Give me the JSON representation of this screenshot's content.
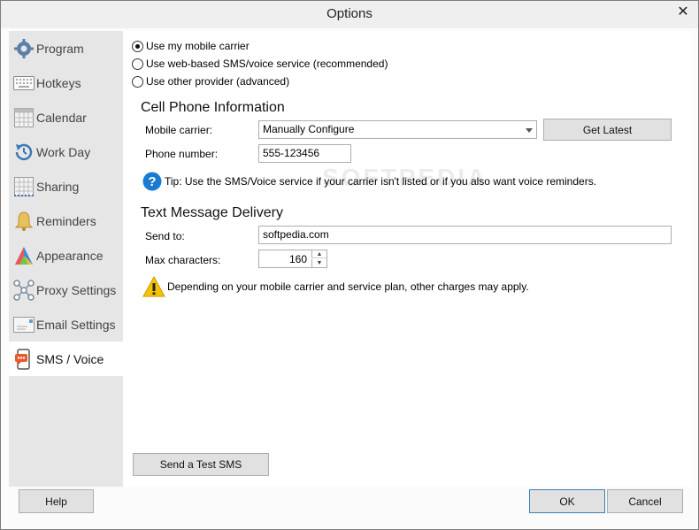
{
  "window": {
    "title": "Options",
    "close_glyph": "✕"
  },
  "sidebar": {
    "items": [
      {
        "label": "Program",
        "icon": "gear-icon"
      },
      {
        "label": "Hotkeys",
        "icon": "keyboard-icon"
      },
      {
        "label": "Calendar",
        "icon": "calendar-icon"
      },
      {
        "label": "Work Day",
        "icon": "clock-icon"
      },
      {
        "label": "Sharing",
        "icon": "sharing-icon"
      },
      {
        "label": "Reminders",
        "icon": "bell-icon"
      },
      {
        "label": "Appearance",
        "icon": "palette-icon"
      },
      {
        "label": "Proxy Settings",
        "icon": "network-icon"
      },
      {
        "label": "Email Settings",
        "icon": "envelope-icon"
      },
      {
        "label": "SMS / Voice",
        "icon": "phone-sms-icon",
        "active": true
      }
    ]
  },
  "service": {
    "options": [
      {
        "label": "Use my mobile carrier",
        "checked": true
      },
      {
        "label": "Use web-based SMS/voice service (recommended)",
        "checked": false
      },
      {
        "label": "Use other provider (advanced)",
        "checked": false
      }
    ]
  },
  "cell_phone": {
    "title": "Cell Phone Information",
    "carrier_label": "Mobile carrier:",
    "carrier_value": "Manually Configure",
    "get_latest_label": "Get Latest",
    "phone_label": "Phone number:",
    "phone_value": "555-123456",
    "tip": "Tip: Use the SMS/Voice service if your carrier isn't listed or if you also want voice reminders."
  },
  "text_delivery": {
    "title": "Text Message Delivery",
    "send_to_label": "Send to:",
    "send_to_value": "softpedia.com",
    "max_chars_label": "Max characters:",
    "max_chars_value": "160",
    "warning": "Depending on your mobile carrier and service plan, other charges may apply."
  },
  "buttons": {
    "test_sms": "Send a Test SMS",
    "help": "Help",
    "ok": "OK",
    "cancel": "Cancel"
  },
  "watermark": "SOFTPEDIA",
  "colors": {
    "sidebar_bg": "#e6e6e6",
    "tip_blue": "#1a7bd1",
    "warning_yellow": "#f5c400"
  }
}
